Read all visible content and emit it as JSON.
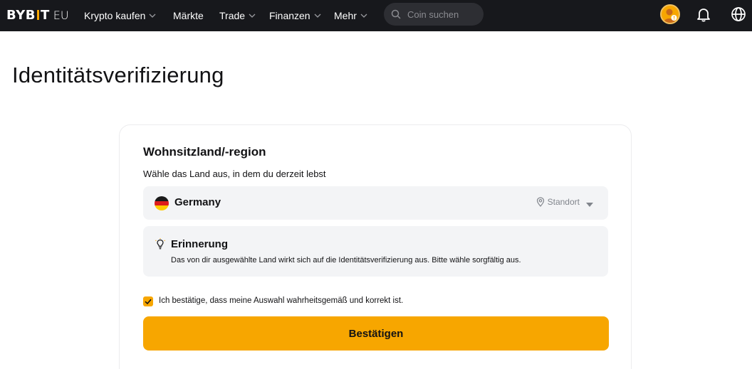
{
  "brand": {
    "logo": "BYBIT",
    "region": "EU",
    "accent": "#f7a600"
  },
  "nav": {
    "items": [
      {
        "label": "Krypto kaufen",
        "has_dropdown": true
      },
      {
        "label": "Märkte",
        "has_dropdown": false
      },
      {
        "label": "Trade",
        "has_dropdown": true
      },
      {
        "label": "Finanzen",
        "has_dropdown": true
      },
      {
        "label": "Mehr",
        "has_dropdown": true
      }
    ],
    "search_placeholder": "Coin suchen",
    "icons": [
      "avatar",
      "bell-icon",
      "globe-icon"
    ]
  },
  "page": {
    "title": "Identitätsverifizierung"
  },
  "card": {
    "title": "Wohnsitzland/-region",
    "subtitle": "Wähle das Land aus, in dem du derzeit lebst",
    "country_select": {
      "value": "Germany",
      "location_label": "Standort"
    },
    "reminder": {
      "title": "Erinnerung",
      "text": "Das von dir ausgewählte Land wirkt sich auf die Identitätsverifizierung aus. Bitte wähle sorgfältig aus."
    },
    "confirm_checkbox": {
      "checked": true,
      "label": "Ich bestätige, dass meine Auswahl wahrheitsgemäß und korrekt ist."
    },
    "submit_label": "Bestätigen"
  }
}
